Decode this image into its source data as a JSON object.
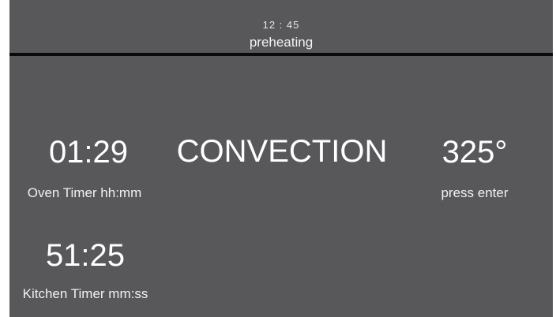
{
  "status": {
    "clock": "12 : 45",
    "state": "preheating"
  },
  "oven_timer": {
    "value": "01:29",
    "label": "Oven Timer hh:mm"
  },
  "mode": {
    "label": "CONVECTION"
  },
  "temperature": {
    "value": "325°",
    "hint": "press enter"
  },
  "kitchen_timer": {
    "value": "51:25",
    "label": "Kitchen Timer mm:ss"
  },
  "colors": {
    "background": "#58585a",
    "divider": "#0a0a0a",
    "text": "#ffffff"
  }
}
